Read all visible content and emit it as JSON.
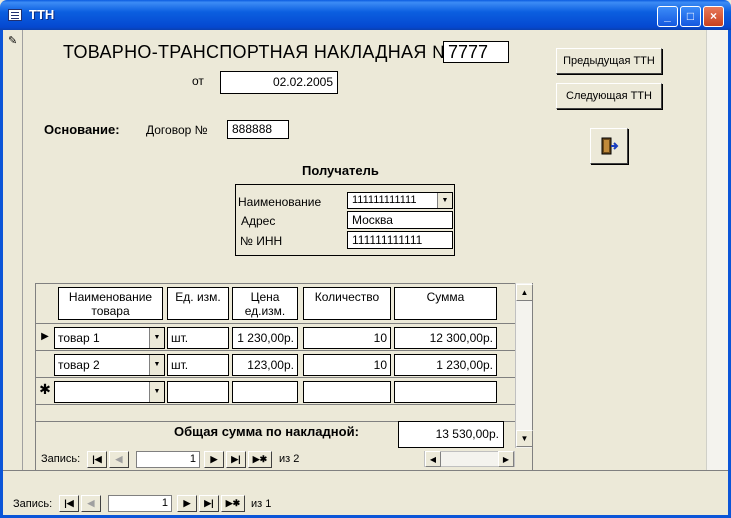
{
  "window": {
    "title": "ТТН",
    "controls": [
      "_",
      "□",
      "×"
    ]
  },
  "form": {
    "heading": "ТОВАРНО-ТРАНСПОРТНАЯ НАКЛАДНАЯ №",
    "number": "7777",
    "date_label": "от",
    "date_value": "02.02.2005",
    "basis_label": "Основание:",
    "contract_label": "Договор №",
    "contract_number": "888888",
    "recipient": {
      "title": "Получатель",
      "name_label": "Наименование",
      "name_value": "111111111111",
      "address_label": "Адрес",
      "address_value": "Москва",
      "inn_label": "№ ИНН",
      "inn_value": "111111111111"
    },
    "buttons": {
      "prev": "Предыдущая ТТН",
      "next": "Следующая ТТН",
      "exit_icon": "exit-door-icon"
    }
  },
  "subform": {
    "columns": [
      "Наименование товара",
      "Ед. изм.",
      "Цена ед.изм.",
      "Количество",
      "Сумма"
    ],
    "rows": [
      {
        "name": "товар 1",
        "unit": "шт.",
        "price": "1 230,00р.",
        "qty": "10",
        "sum": "12 300,00р."
      },
      {
        "name": "товар 2",
        "unit": "шт.",
        "price": "123,00р.",
        "qty": "10",
        "sum": "1 230,00р."
      }
    ],
    "total_label": "Общая сумма по накладной:",
    "total_value": "13 530,00р.",
    "nav": {
      "label": "Запись:",
      "current": "1",
      "of_label": "из 2"
    }
  },
  "main_nav": {
    "label": "Запись:",
    "current": "1",
    "of_label": "из 1"
  }
}
